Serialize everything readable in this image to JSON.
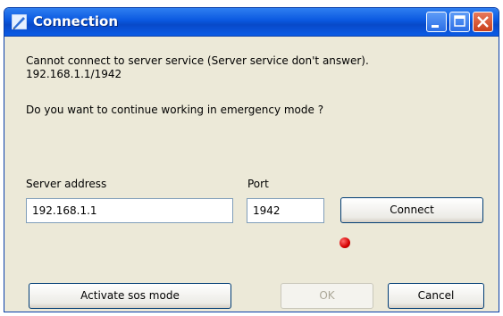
{
  "window": {
    "title": "Connection",
    "controls": [
      "minimize",
      "maximize",
      "close"
    ]
  },
  "message": {
    "line1": "Cannot connect to server service (Server service don't answer).",
    "line2": "192.168.1.1/1942",
    "question": "Do you want to continue working in emergency mode ?"
  },
  "form": {
    "server_label": "Server address",
    "server_value": "192.168.1.1",
    "port_label": "Port",
    "port_value": "1942",
    "connect_label": "Connect",
    "status_color": "#d40000"
  },
  "buttons": {
    "sos_label": "Activate sos mode",
    "ok_label": "OK",
    "cancel_label": "Cancel"
  },
  "colors": {
    "titlebar": "#0a58e0",
    "window_bg": "#ece9d8"
  }
}
